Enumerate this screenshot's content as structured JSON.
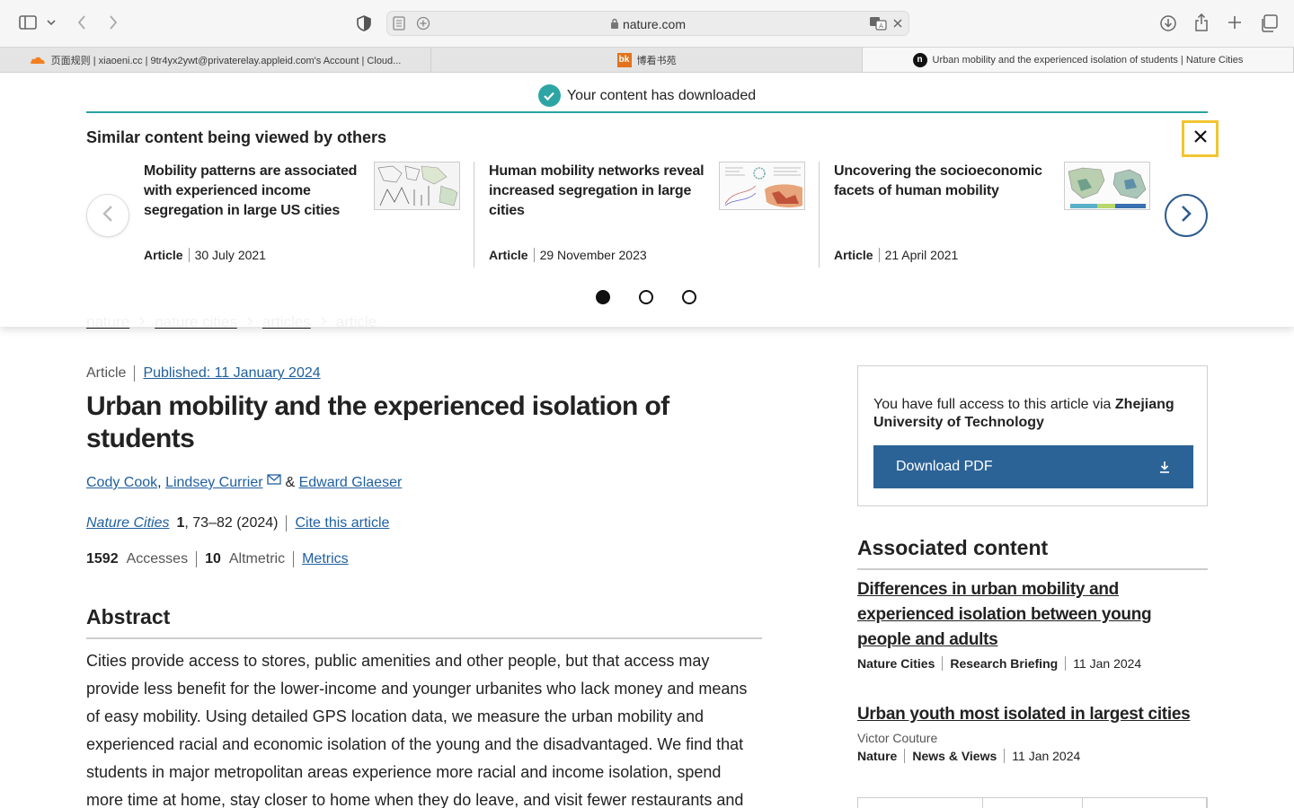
{
  "browser": {
    "url": "nature.com",
    "tabs": [
      {
        "title": "页面规则 | xiaoeni.cc | 9tr4yx2ywt@privaterelay.appleid.com's Account | Cloud...",
        "favicon": "cloudflare-icon"
      },
      {
        "title": "博看书苑",
        "favicon": "bk-icon",
        "favicon_text": "bk"
      },
      {
        "title": "Urban mobility and the experienced isolation of students | Nature Cities",
        "favicon": "nature-n-icon",
        "favicon_text": "n"
      }
    ],
    "active_tab": 2
  },
  "overlay": {
    "download_message": "Your content has downloaded",
    "heading": "Similar content being viewed by others",
    "cards": [
      {
        "title": "Mobility patterns are associated with experienced income segregation in large US cities",
        "type": "Article",
        "date": "30 July 2021"
      },
      {
        "title": "Human mobility networks reveal increased segregation in large cities",
        "type": "Article",
        "date": "29 November 2023"
      },
      {
        "title": "Uncovering the socioeconomic facets of human mobility",
        "type": "Article",
        "date": "21 April 2021"
      }
    ],
    "carousel_pages": 3,
    "carousel_current": 1
  },
  "breadcrumb": [
    "nature",
    "nature cities",
    "articles",
    "article"
  ],
  "article": {
    "type": "Article",
    "published": "Published: 11 January 2024",
    "title": "Urban mobility and the experienced isolation of students",
    "authors": [
      "Cody Cook",
      "Lindsey Currier",
      "Edward Glaeser"
    ],
    "author_sep": ",",
    "author_amp": "&",
    "journal": "Nature Cities",
    "volume": "1",
    "pages_year": ", 73–82 (2024)",
    "cite": "Cite this article",
    "accesses_count": "1592",
    "accesses_label": "Accesses",
    "altmetric_count": "10",
    "altmetric_label": "Altmetric",
    "metrics_link": "Metrics",
    "abstract_heading": "Abstract",
    "abstract": "Cities provide access to stores, public amenities and other people, but that access may provide less benefit for the lower-income and younger urbanites who lack money and means of easy mobility. Using detailed GPS location data, we measure the urban mobility and experienced racial and economic isolation of the young and the disadvantaged. We find that students in major metropolitan areas experience more racial and income isolation, spend more time at home, stay closer to home when they do leave, and visit fewer restaurants and"
  },
  "sidebar": {
    "access_text": "You have full access to this article via",
    "institution": "Zhejiang University of Technology",
    "download_pdf": "Download PDF",
    "associated_heading": "Associated content",
    "associated": [
      {
        "title": "Differences in urban mobility and experienced isolation between young people and adults",
        "author": "",
        "journal": "Nature Cities",
        "kind": "Research Briefing",
        "date": "11 Jan 2024"
      },
      {
        "title": "Urban youth most isolated in largest cities",
        "author": "Victor Couture",
        "journal": "Nature",
        "kind": "News & Views",
        "date": "11 Jan 2024"
      }
    ]
  },
  "colors": {
    "link": "#2060a0",
    "pdf_button": "#2c6397",
    "teal": "#2ea5a5",
    "focus": "#f2c530"
  }
}
